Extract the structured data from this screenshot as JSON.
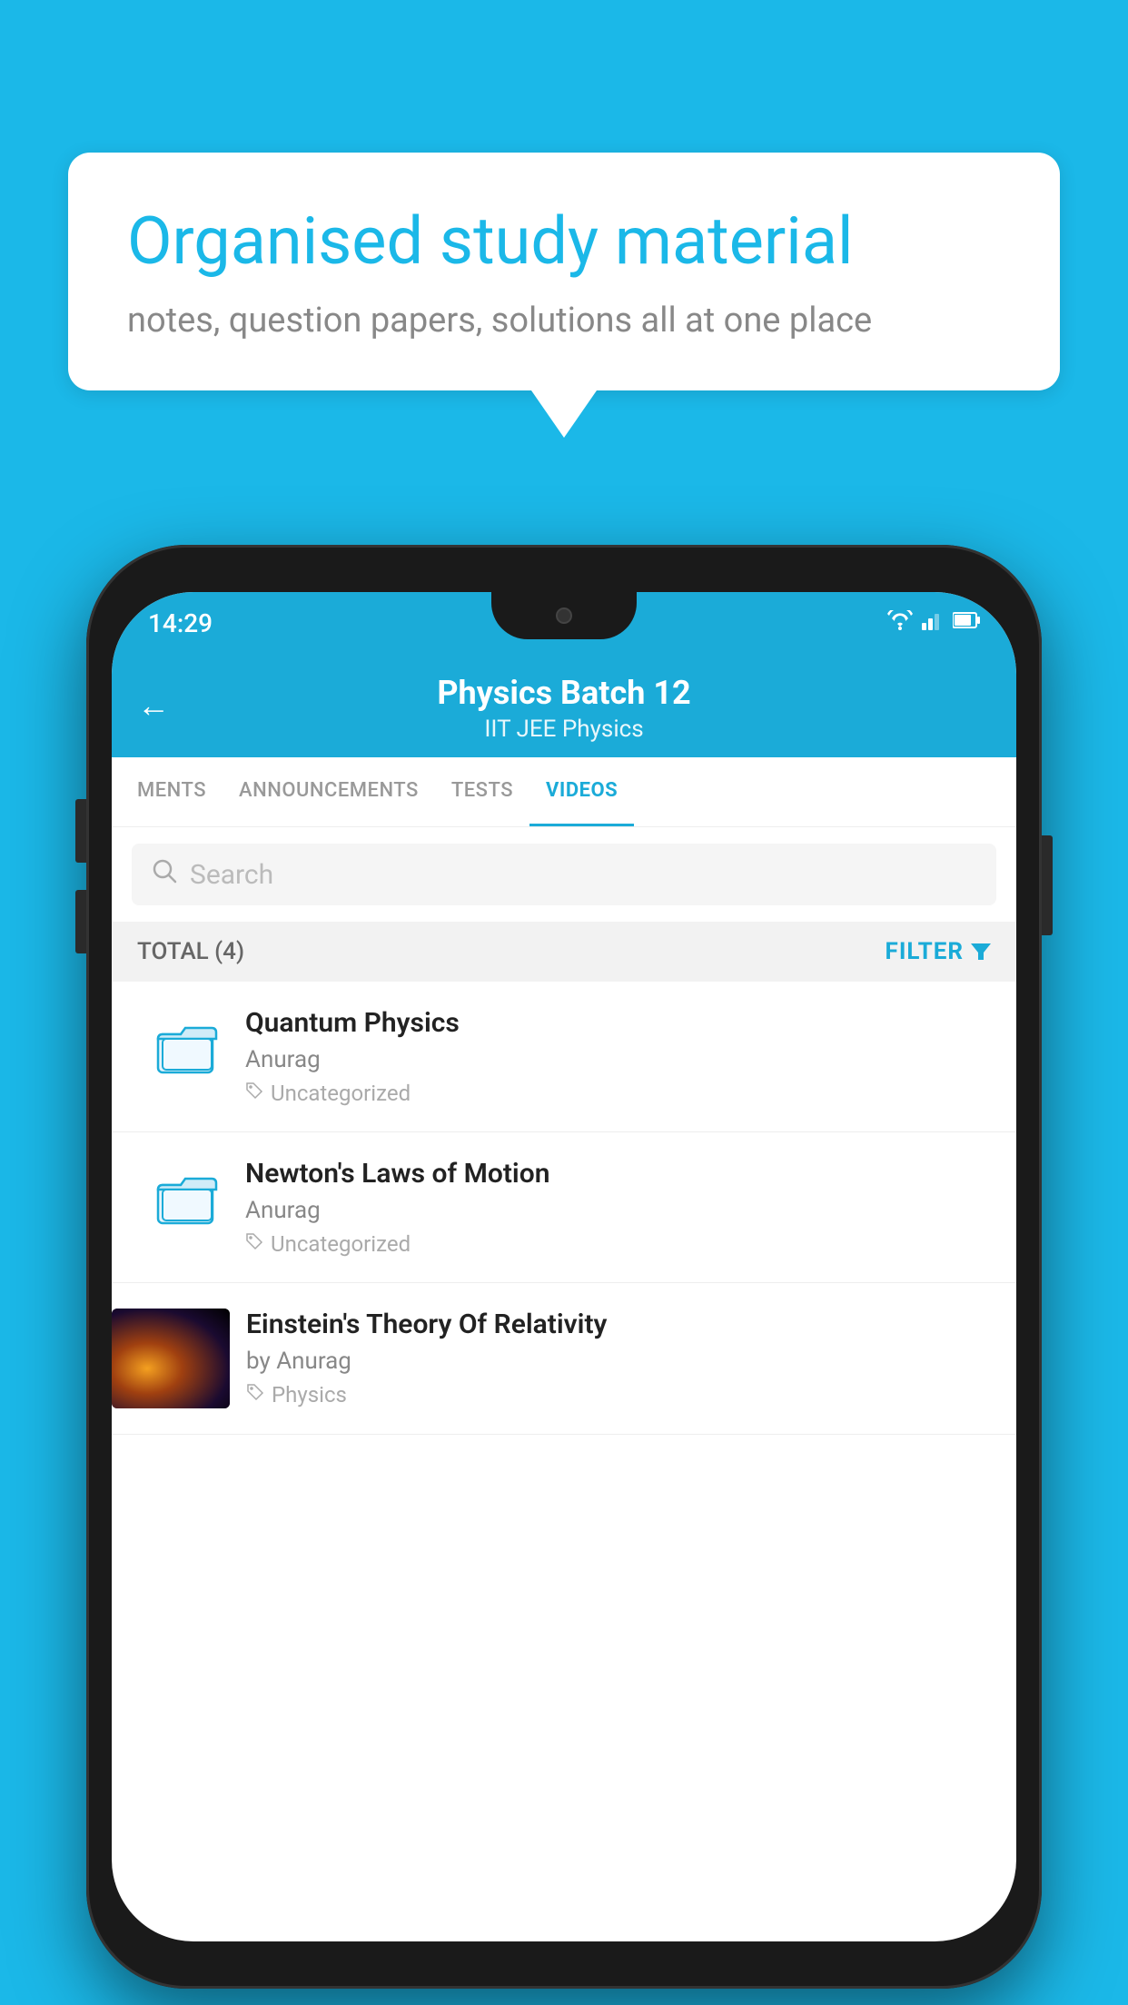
{
  "background": {
    "color": "#1BB8E8"
  },
  "speechBubble": {
    "title": "Organised study material",
    "subtitle": "notes, question papers, solutions all at one place"
  },
  "phone": {
    "statusBar": {
      "time": "14:29",
      "icons": [
        "wifi",
        "signal",
        "battery"
      ]
    },
    "header": {
      "backLabel": "←",
      "title": "Physics Batch 12",
      "subtitle": "IIT JEE   Physics"
    },
    "tabs": [
      {
        "label": "MENTS",
        "active": false
      },
      {
        "label": "ANNOUNCEMENTS",
        "active": false
      },
      {
        "label": "TESTS",
        "active": false
      },
      {
        "label": "VIDEOS",
        "active": true
      }
    ],
    "search": {
      "placeholder": "Search"
    },
    "filterBar": {
      "total": "TOTAL (4)",
      "filterLabel": "FILTER"
    },
    "videoList": [
      {
        "title": "Quantum Physics",
        "author": "Anurag",
        "tag": "Uncategorized",
        "hasThumbnail": false
      },
      {
        "title": "Newton's Laws of Motion",
        "author": "Anurag",
        "tag": "Uncategorized",
        "hasThumbnail": false
      },
      {
        "title": "Einstein's Theory Of Relativity",
        "author": "by Anurag",
        "tag": "Physics",
        "hasThumbnail": true
      }
    ]
  }
}
